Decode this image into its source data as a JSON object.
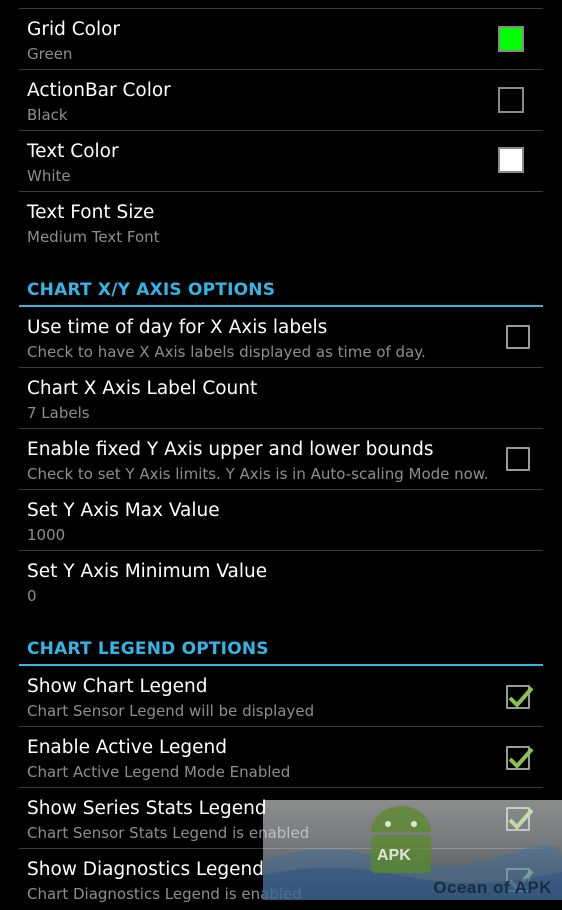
{
  "settings": {
    "grid_color": {
      "title": "Grid Color",
      "summary": "Green",
      "swatch": "#00ff00"
    },
    "actionbar_color": {
      "title": "ActionBar Color",
      "summary": "Black",
      "swatch": "#000000"
    },
    "text_color": {
      "title": "Text Color",
      "summary": "White",
      "swatch": "#ffffff"
    },
    "text_font_size": {
      "title": "Text Font Size",
      "summary": "Medium Text Font"
    }
  },
  "axis_section": {
    "header": "CHART X/Y AXIS OPTIONS",
    "time_of_day": {
      "title": "Use time of day for X Axis labels",
      "summary": "Check to have X Axis labels displayed as time of day.",
      "checked": false
    },
    "x_label_count": {
      "title": "Chart X Axis Label Count",
      "summary": "7 Labels"
    },
    "fixed_bounds": {
      "title": "Enable fixed Y Axis upper and lower bounds",
      "summary": "Check to set Y Axis limits. Y Axis is in Auto-scaling Mode now.",
      "checked": false
    },
    "y_max": {
      "title": "Set Y Axis Max Value",
      "summary": "1000"
    },
    "y_min": {
      "title": "Set Y Axis Minimum Value",
      "summary": "0"
    }
  },
  "legend_section": {
    "header": "CHART LEGEND OPTIONS",
    "show_legend": {
      "title": "Show Chart Legend",
      "summary": "Chart Sensor Legend will be displayed",
      "checked": true
    },
    "active_legend": {
      "title": "Enable Active Legend",
      "summary": "Chart Active Legend Mode Enabled",
      "checked": true
    },
    "series_stats": {
      "title": "Show Series Stats Legend",
      "summary": "Chart Sensor Stats Legend is enabled",
      "checked": true
    },
    "diagnostics": {
      "title": "Show Diagnostics Legend",
      "summary": "Chart Diagnostics Legend is enabled",
      "checked": true
    }
  },
  "watermark": {
    "text": "Ocean of APK",
    "badge": "APK"
  },
  "colors": {
    "accent": "#33b5e5",
    "check": "#8bc34a"
  }
}
